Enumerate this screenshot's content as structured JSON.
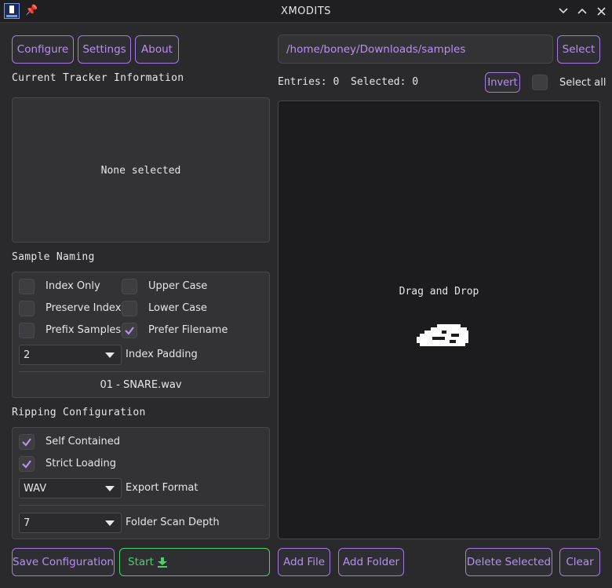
{
  "window": {
    "title": "XMODITS",
    "app_icon": "app-icon",
    "pin_icon": "pin-icon",
    "controls": [
      "chevron-down-icon",
      "chevron-up-icon",
      "close-icon"
    ]
  },
  "menu": {
    "configure": "Configure",
    "settings": "Settings",
    "about": "About"
  },
  "tracker_info": {
    "heading": "Current Tracker Information",
    "status": "None selected"
  },
  "sample_naming": {
    "heading": "Sample Naming",
    "options": [
      {
        "label": "Index Only",
        "checked": false
      },
      {
        "label": "Upper Case",
        "checked": false
      },
      {
        "label": "Preserve Index",
        "checked": false
      },
      {
        "label": "Lower Case",
        "checked": false
      },
      {
        "label": "Prefix Samples",
        "checked": false
      },
      {
        "label": "Prefer Filename",
        "checked": true
      }
    ],
    "index_padding_value": "2",
    "index_padding_label": "Index Padding",
    "preview": "01 - SNARE.wav"
  },
  "ripping": {
    "heading": "Ripping Configuration",
    "self_contained": {
      "label": "Self Contained",
      "checked": true
    },
    "strict_loading": {
      "label": "Strict Loading",
      "checked": true
    },
    "export_format_value": "WAV",
    "export_format_label": "Export Format",
    "scan_depth_value": "7",
    "scan_depth_label": "Folder Scan Depth"
  },
  "bottom_left": {
    "save": "Save Configuration",
    "start": "Start"
  },
  "path": {
    "value": "/home/boney/Downloads/samples",
    "select": "Select"
  },
  "entries": {
    "entries_text": "Entries: 0",
    "selected_text": "Selected: 0",
    "invert": "Invert",
    "select_all": "Select all",
    "select_all_checked": false
  },
  "drop": {
    "text": "Drag and Drop"
  },
  "bottom_right": {
    "add_file": "Add File",
    "add_folder": "Add Folder",
    "delete_selected": "Delete Selected",
    "clear": "Clear"
  },
  "colors": {
    "accent": "#b790f0",
    "accent_border": "#a57ae0",
    "green": "#4cd06a",
    "background": "#2a2a2c",
    "panel": "#333336",
    "drop_area": "#1c1c1e"
  }
}
